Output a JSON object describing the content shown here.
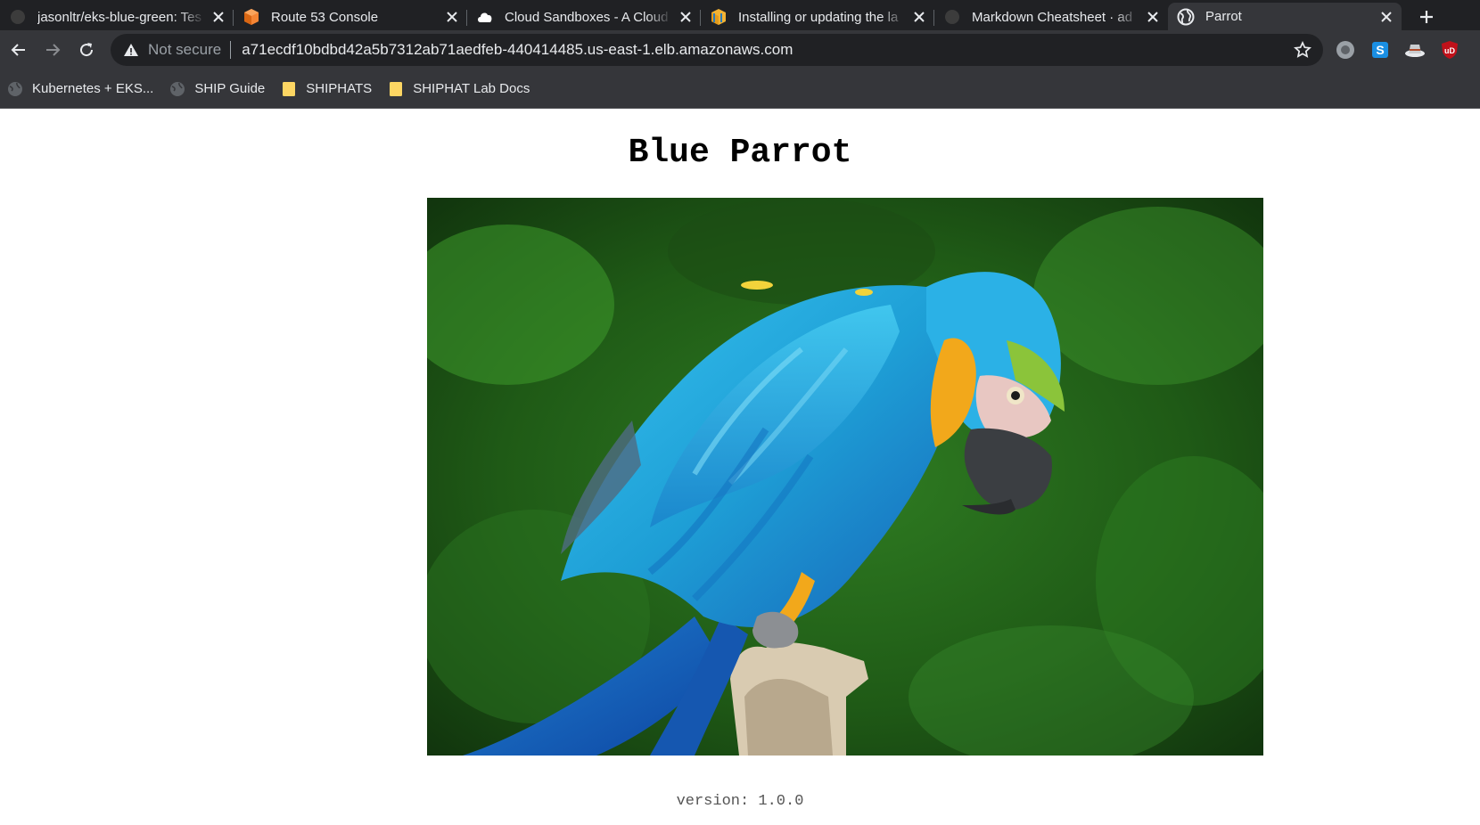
{
  "tabs": [
    {
      "title": "jasonltr/eks-blue-green: Tes",
      "favicon": "github-icon",
      "active": false
    },
    {
      "title": "Route 53 Console",
      "favicon": "aws-cube-icon",
      "active": false
    },
    {
      "title": "Cloud Sandboxes - A Cloud",
      "favicon": "cloud-icon",
      "active": false
    },
    {
      "title": "Installing or updating the la",
      "favicon": "aws-package-icon",
      "active": false
    },
    {
      "title": "Markdown Cheatsheet · ad",
      "favicon": "github-icon",
      "active": false
    },
    {
      "title": "Parrot",
      "favicon": "globe-icon",
      "active": true
    }
  ],
  "toolbar": {
    "security_label": "Not secure",
    "url": "a71ecdf10bdbd42a5b7312ab71aedfeb-440414485.us-east-1.elb.amazonaws.com"
  },
  "extensions": [
    "extension-grey-icon",
    "extension-s-icon",
    "extension-hat-icon",
    "ublock-icon"
  ],
  "bookmarks": [
    {
      "label": "Kubernetes + EKS...",
      "icon": "globe-icon"
    },
    {
      "label": "SHIP Guide",
      "icon": "globe-icon"
    },
    {
      "label": "SHIPHATS",
      "icon": "folder-icon"
    },
    {
      "label": "SHIPHAT Lab Docs",
      "icon": "folder-icon"
    }
  ],
  "page": {
    "title": "Blue Parrot",
    "version_text": "version: 1.0.0"
  },
  "colors": {
    "tabstrip": "#202124",
    "toolbar": "#35363a",
    "parrot_blue": "#1e9fd6",
    "parrot_yellow": "#f2a81b",
    "foliage_green": "#2f7d22"
  }
}
